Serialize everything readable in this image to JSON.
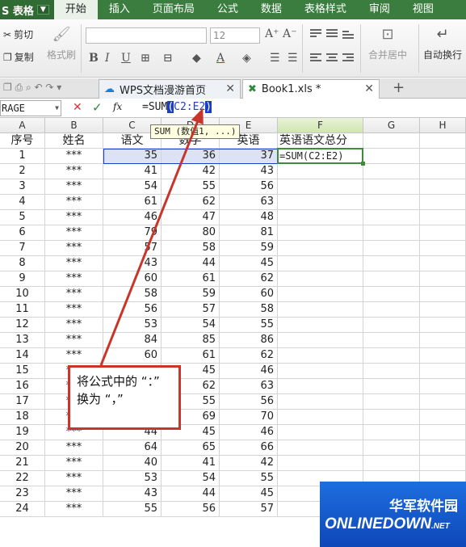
{
  "menubar": {
    "app_name": "S 表格",
    "items": [
      "开始",
      "插入",
      "页面布局",
      "公式",
      "数据",
      "表格样式",
      "审阅",
      "视图"
    ]
  },
  "ribbon": {
    "cut": "剪切",
    "copy": "复制",
    "format_painter": "格式刷",
    "font_size": "12",
    "merge_center": "合并居中",
    "auto_wrap": "自动换行"
  },
  "tabs": [
    {
      "label": "WPS文档漫游首页"
    },
    {
      "label": "Book1.xls *"
    }
  ],
  "formula_bar": {
    "name_box": "RAGE",
    "fx": "fx",
    "formula_prefix": "=SUM",
    "open_paren": "(",
    "range": "C2:E2",
    "close_paren": ")",
    "tooltip": "SUM (数值1, ...)"
  },
  "columns": [
    "A",
    "B",
    "C",
    "D",
    "E",
    "F",
    "G",
    "H"
  ],
  "header_row": {
    "num": "1",
    "cells": [
      "序号",
      "姓名",
      "语文",
      "数学",
      "英语",
      "英语语文总分"
    ]
  },
  "rows": [
    {
      "r": "2",
      "a": "1",
      "b": "***",
      "c": "35",
      "d": "36",
      "e": "37",
      "f": "=SUM(C2:E2)"
    },
    {
      "r": "3",
      "a": "2",
      "b": "***",
      "c": "41",
      "d": "42",
      "e": "43",
      "f": ""
    },
    {
      "r": "4",
      "a": "3",
      "b": "***",
      "c": "54",
      "d": "55",
      "e": "56",
      "f": ""
    },
    {
      "r": "5",
      "a": "4",
      "b": "***",
      "c": "61",
      "d": "62",
      "e": "63",
      "f": ""
    },
    {
      "r": "6",
      "a": "5",
      "b": "***",
      "c": "46",
      "d": "47",
      "e": "48",
      "f": ""
    },
    {
      "r": "7",
      "a": "6",
      "b": "***",
      "c": "79",
      "d": "80",
      "e": "81",
      "f": ""
    },
    {
      "r": "8",
      "a": "7",
      "b": "***",
      "c": "57",
      "d": "58",
      "e": "59",
      "f": ""
    },
    {
      "r": "9",
      "a": "8",
      "b": "***",
      "c": "43",
      "d": "44",
      "e": "45",
      "f": ""
    },
    {
      "r": "10",
      "a": "9",
      "b": "***",
      "c": "60",
      "d": "61",
      "e": "62",
      "f": ""
    },
    {
      "r": "11",
      "a": "10",
      "b": "***",
      "c": "58",
      "d": "59",
      "e": "60",
      "f": ""
    },
    {
      "r": "12",
      "a": "11",
      "b": "***",
      "c": "56",
      "d": "57",
      "e": "58",
      "f": ""
    },
    {
      "r": "13",
      "a": "12",
      "b": "***",
      "c": "53",
      "d": "54",
      "e": "55",
      "f": ""
    },
    {
      "r": "14",
      "a": "13",
      "b": "***",
      "c": "84",
      "d": "85",
      "e": "86",
      "f": ""
    },
    {
      "r": "15",
      "a": "14",
      "b": "***",
      "c": "60",
      "d": "61",
      "e": "62",
      "f": ""
    },
    {
      "r": "16",
      "a": "15",
      "b": "***",
      "c": "44",
      "d": "45",
      "e": "46",
      "f": ""
    },
    {
      "r": "17",
      "a": "16",
      "b": "***",
      "c": "61",
      "d": "62",
      "e": "63",
      "f": ""
    },
    {
      "r": "18",
      "a": "17",
      "b": "***",
      "c": "54",
      "d": "55",
      "e": "56",
      "f": ""
    },
    {
      "r": "19",
      "a": "18",
      "b": "***",
      "c": "68",
      "d": "69",
      "e": "70",
      "f": ""
    },
    {
      "r": "20",
      "a": "19",
      "b": "***",
      "c": "44",
      "d": "45",
      "e": "46",
      "f": ""
    },
    {
      "r": "21",
      "a": "20",
      "b": "***",
      "c": "64",
      "d": "65",
      "e": "66",
      "f": ""
    },
    {
      "r": "22",
      "a": "21",
      "b": "***",
      "c": "40",
      "d": "41",
      "e": "42",
      "f": ""
    },
    {
      "r": "23",
      "a": "22",
      "b": "***",
      "c": "53",
      "d": "54",
      "e": "55",
      "f": ""
    },
    {
      "r": "24",
      "a": "23",
      "b": "***",
      "c": "43",
      "d": "44",
      "e": "45",
      "f": ""
    },
    {
      "r": "25",
      "a": "24",
      "b": "***",
      "c": "55",
      "d": "56",
      "e": "57",
      "f": ""
    }
  ],
  "callout": {
    "line1": "将公式中的 “：”",
    "line2": "换为 “，”"
  },
  "watermark": {
    "cn": "华军软件园",
    "en": "ONLINEDOWN",
    "suffix": ".NET"
  },
  "colors": {
    "accent": "#3b7d3f",
    "arrow": "#c9342b",
    "range_highlight": "#1b3ec9"
  }
}
